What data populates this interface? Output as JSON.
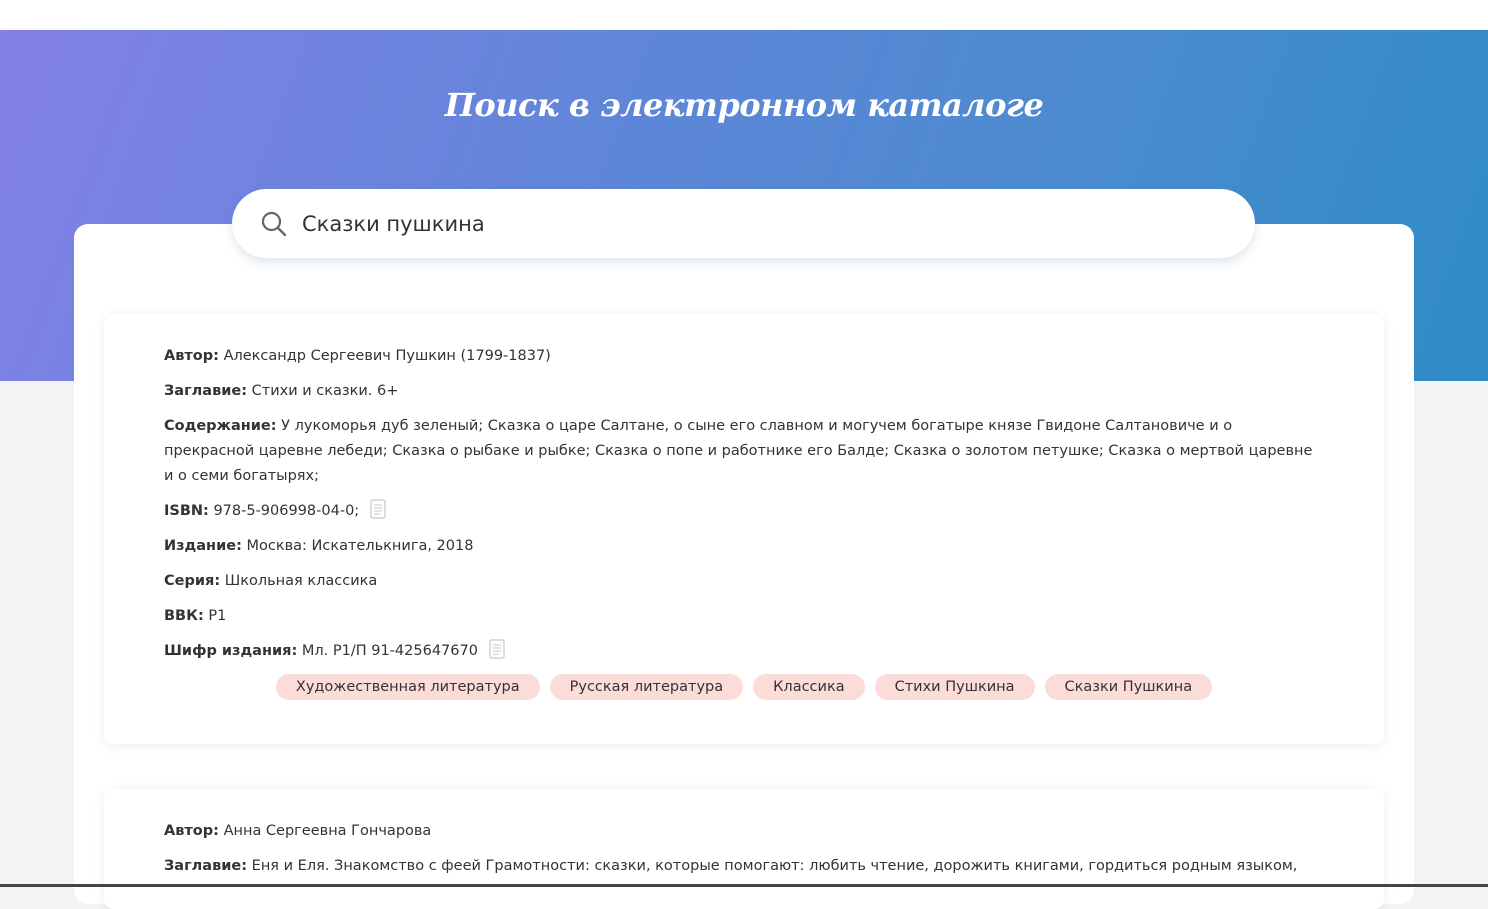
{
  "header": {
    "title": "Поиск в электронном каталоге"
  },
  "search": {
    "value": "Сказки пушкина",
    "icon": "search-icon"
  },
  "results": [
    {
      "author_label": "Автор:",
      "author": "Александр Сергеевич Пушкин (1799-1837)",
      "title_label": "Заглавие:",
      "title": "Стихи и сказки. 6+",
      "contents_label": "Содержание:",
      "contents": "У лукоморья дуб зеленый; Сказка о царе Салтане, о сыне его славном и могучем богатыре князе Гвидоне Салтановиче и о прекрасной царевне лебеди; Сказка о рыбаке и рыбке; Сказка о попе и работнике его Балде; Сказка о золотом петушке; Сказка о мертвой царевне и о семи богатырях;",
      "isbn_label": "ISBN:",
      "isbn": "978-5-906998-04-0;",
      "edition_label": "Издание:",
      "edition": "Москва: Искателькнига, 2018",
      "series_label": "Серия:",
      "series": "Школьная классика",
      "bbk_label": "ВВК:",
      "bbk": "Р1",
      "cipher_label": "Шифр издания:",
      "cipher": "Мл. Р1/П 91-425647670",
      "tags": [
        "Художественная литература",
        "Русская литература",
        "Классика",
        "Стихи Пушкина",
        "Сказки Пушкина"
      ]
    },
    {
      "author_label": "Автор:",
      "author": "Анна Сергеевна Гончарова",
      "title_label": "Заглавие:",
      "title": "Еня и Еля. Знакомство с феей Грамотности: сказки, которые помогают: любить чтение, дорожить книгами, гордиться родным языком,"
    }
  ],
  "colors": {
    "hero_gradient_start": "#8380e6",
    "hero_gradient_end": "#2e8bc6",
    "tag_background": "#fbdcd9"
  }
}
